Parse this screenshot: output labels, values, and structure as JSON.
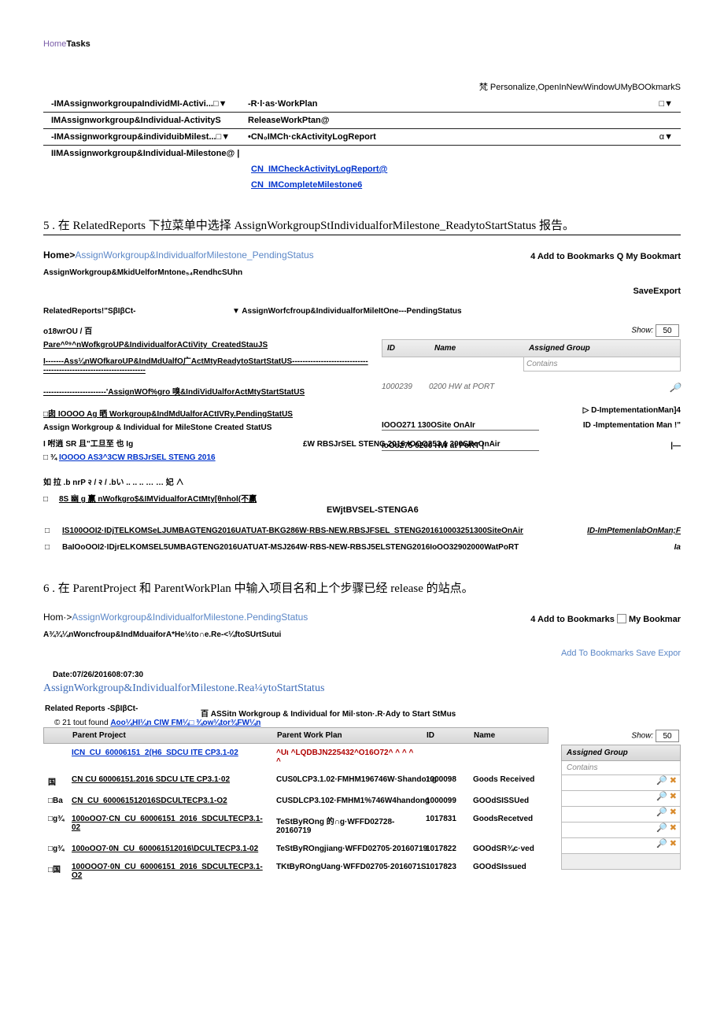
{
  "nav": {
    "home": "Home",
    "tasks": "Tasks"
  },
  "section1": {
    "personalize": "梵 Personalize,OpenInNewWindowUMyBOOkmarkS",
    "rows": [
      {
        "c1": "-IMAssignworkgroupaIndividMI-Activi...□▼",
        "c2": "-R·l·as·WorkPlan",
        "c3": "□▼"
      },
      {
        "c1": "IMAssignworkgroup&Individual-ActivityS",
        "c2": "ReleaseWorkPtan@",
        "c3": ""
      },
      {
        "c1": "-IMAssignworkgroup&individuibMilest...□▼",
        "c2": "•CN₀IMCh·ckActivityLogReport",
        "c3": "α▼"
      },
      {
        "c1": "IIMAssignworkgroup&Individual-Milestone@ |",
        "c2": "",
        "c3": ""
      }
    ],
    "sub1": "CN_IMCheckActivityLogReport@",
    "sub2": "CN_IMCompleteMilestone6"
  },
  "step5": {
    "text": "5    . 在 RelatedReports 下拉菜单中选择 AssignWorkgroupStIndividualforMilestone_ReadytoStartStatus 报告。"
  },
  "bc5": {
    "home": "Home>",
    "path": "AssignWorkgroup&IndividualforMilestone_PendingStatus",
    "right": "4 Add to Bookmarks Q My Bookmart"
  },
  "sub5": "AssignWorkgroup&MkidUelforMntone₅₄RendhcSUhn",
  "saveexport": "SaveExport",
  "related5": {
    "label": "RelatedReports!\"SβIβCt-",
    "value": "▼ AssignWorfcfroup&IndividualforMileItOne---PendingStatus"
  },
  "left5": {
    "r0": "o18wrOU / 百",
    "r1": "Pare^⁰⁹^nWofkgroUP&IndividualforACtiVity_CreatedStauJS",
    "r2": "I-------Ass¼nWOfkaroUP&IndMdUalfO广ActMtyReadytoStartStatUS--------------------------------------------------------------------",
    "r3": "------------------------'AssignWOf%gro 嗅&IndiVidUalforActMtyStartStatUS",
    "r4": "□囱 IOOOO Ag 晒  Workgroup&IndMdUalforACtIVRy.PendingStatUS",
    "r4b": "£W RBSJrSEL STENG 2016 IOOO253 1 300SReOnAir",
    "r5": "Assign Workgroup & Individual for MileStone Created StatUS",
    "r6": "I 咐逍 SR 且\"工旦至 也 Ig",
    "r7": "□ ¾ IOOOO AS3^3CW RBSJrSEL STENG 2016",
    "r8": "如 拉 .b nrP २ / २ / .bい .. .. .. …    … 妃 ∧",
    "r9": "8S 幽 g 赢  nWofkgro$&IMVidualforACtMty[θnhol(不赢",
    "r9b": "EWjtBVSEL-STENGA6"
  },
  "grid5": {
    "show": "Show:",
    "showval": "50",
    "id": "ID",
    "name": "Name",
    "ag": "Assigned Group",
    "contains": "Contains",
    "d1id": "1000239",
    "d1nm": "0200 HW at PORT",
    "mid1a": "▷  D-ImptementationMan]4",
    "mid1b": "IOOO271 130OSite OnAIr",
    "mid1c": "ID -Imptementation Man !\"",
    "mid2": "IoOo275 0200 HW at PoRT |",
    "dash": "|—"
  },
  "longrows": [
    {
      "sq": "□",
      "tx": "IS100OOI2·IDjTELKOMSeLJUMBAGTENG2016UATUAT-BKG286W·RBS-NEW.RBSJFSEL_STENG201610003251300SiteOnAir",
      "rt": "ID-ImPtemenlabOnMan;F"
    },
    {
      "sq": "□",
      "tx": "BaIOoOOI2·IDjrELKOMSEL5UMBAGTENG2016UATUAT-MSJ264W·RBS-NEW-RBSJ5ELSTENG2016IoOO32902000WatPoRT",
      "rt": "Ia"
    }
  ],
  "step6": {
    "text": "6    . 在 ParentProject 和 ParentWorkPlan 中输入项目名和上个步骤已经 release 的站点。"
  },
  "bc6": {
    "home": "Hom·>",
    "path": "AssignWorkgroup&IndividualforMilestone.PendingStatus",
    "right_l": "4 Add to Bookmarks",
    "right_r": "My Bookmar"
  },
  "sub6": "A¾¾¼nWorιcfroup&IndMduaiforA*He½to∩e.Re-<¼ftoSUrtSutui",
  "lightlink": "Add To Bookmarks Save Expor",
  "dateline": "Date:07/26/201608:07:30",
  "reportlink": "AssignWorkgroup&IndividualforMilestone.Rea¼ytoStartStatus",
  "related6": "Related Reports -SβIβCt-",
  "baihead": "百  ASSitn Workgroup & Individual for Mil·ston·.R·Ady to Start StMus",
  "found": {
    "pre": "© 21 tout found ",
    "link": "Aoo¼HI¼n CIW FM¼□ ¾ow¼tor¾FW¼n"
  },
  "bheaders": {
    "pp": "Parent Project",
    "pw": "Parent Work Plan",
    "id": "ID",
    "nm": "Name",
    "ag": "Assigned Group"
  },
  "brows": [
    {
      "cb": "",
      "pp": "ICN_CU_60006151_2(H6_SDCU ITE CP3.1-02",
      "ppcls": "blue-u",
      "pw": "^Uι ^LQDBJN225432^O16O72^ ^ ^ ^ ^",
      "pwcls": "red",
      "id": "",
      "nm": ""
    },
    {
      "cb": "国",
      "pp": "CN CU 60006151.2016 SDCU LTE CP3.1·02",
      "ppcls": "",
      "pw": "CUS0LCP3.1.02·FMHM196746W·Shando∩g",
      "pwcls": "",
      "id": "1000098",
      "nm": "Goods Received"
    },
    {
      "cb": "□Ba",
      "pp": "CN_CU_600061512016SDCULTECP3.1-O2",
      "ppcls": "",
      "pw": "CUSDLCP3.102·FMHM1%746W4handong",
      "pwcls": "",
      "id": "1000099",
      "nm": "GOOdSISSUed"
    },
    {
      "cb": "□g¾",
      "pp": "100oOO7·CN_CU_60006151_2016_SDCULTECP3.1-02",
      "ppcls": "",
      "pw": "TeStByROng 的∩g·WFFD02728-20160719",
      "pwcls": "",
      "id": "1017831",
      "nm": "GoodsRecetved"
    },
    {
      "cb": "□g¾",
      "pp": "100oOO7·0N_CU_600061512016\\DCULTECP3.1-02",
      "ppcls": "",
      "pw": "TeStByROngjiang·WFFD02705·20160719",
      "pwcls": "",
      "id": "1017822",
      "nm": "GOOdSR¾c·ved"
    },
    {
      "cb": "□国",
      "pp": "100OOO7·0N_CU_60006151_2016_SDCULTECP3.1-O2",
      "ppcls": "",
      "pw": "TKtByROngUang·WFFD02705·2016071S",
      "pwcls": "",
      "id": "1017823",
      "nm": "GOOdSIssued"
    }
  ],
  "ag": {
    "header": "Assigned Group",
    "contains": "Contains",
    "show": "Show:",
    "showval": "50",
    "mag": "🔎",
    "x": "✖"
  }
}
